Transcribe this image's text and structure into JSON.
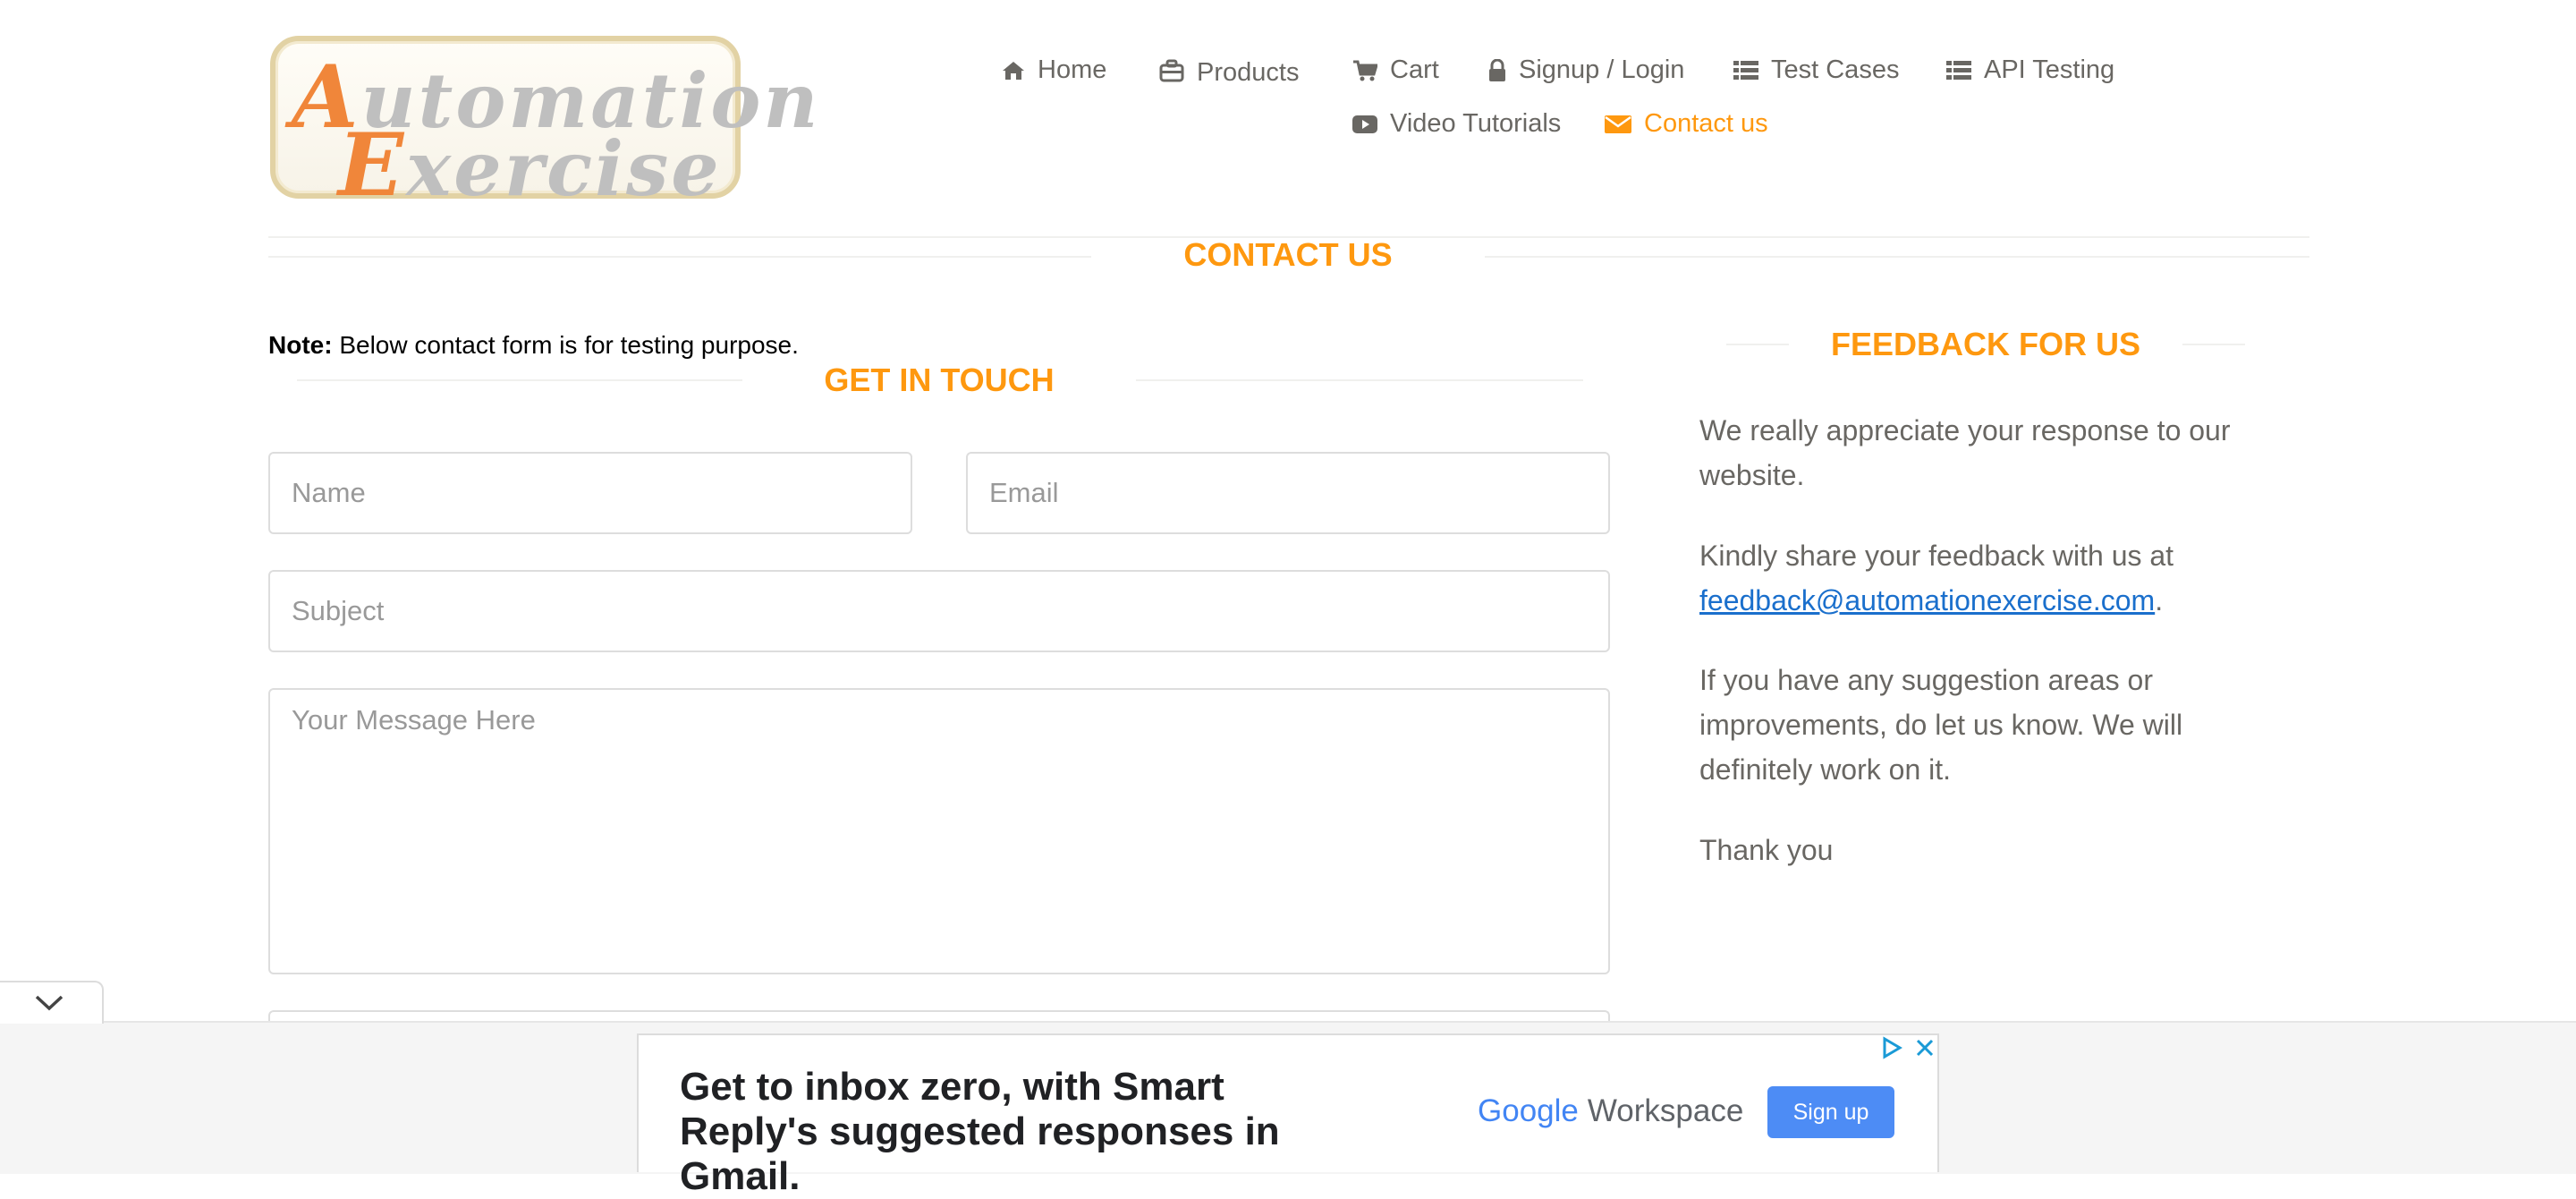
{
  "logo": {
    "line1_cap": "A",
    "line1_rest": "utomation",
    "line2_cap": "E",
    "line2_rest": "xercise"
  },
  "nav": {
    "home": "Home",
    "products": "Products",
    "cart": "Cart",
    "signup_login": "Signup / Login",
    "test_cases": "Test Cases",
    "api_testing": "API Testing",
    "video_tutorials": "Video Tutorials",
    "contact_us": "Contact us"
  },
  "page_title": "CONTACT US",
  "note": {
    "label": "Note:",
    "text": " Below contact form is for testing purpose."
  },
  "form": {
    "title": "GET IN TOUCH",
    "name_placeholder": "Name",
    "email_placeholder": "Email",
    "subject_placeholder": "Subject",
    "message_placeholder": "Your Message Here"
  },
  "feedback": {
    "title": "FEEDBACK FOR US",
    "p1": "We really appreciate your response to our website.",
    "p2_prefix": "Kindly share your feedback with us at ",
    "email": "feedback@automationexercise.com",
    "p2_suffix": ".",
    "p3": "If you have any suggestion areas or improvements, do let us know. We will definitely work on it.",
    "p4": "Thank you"
  },
  "ad": {
    "headline": "Get to inbox zero, with Smart Reply's suggested responses in Gmail.",
    "brand_g": "Google",
    "brand_w": "Workspace",
    "cta": "Sign up"
  },
  "colors": {
    "accent": "#FE980F",
    "text": "#696763",
    "link": "#1A6FCC",
    "ad_button": "#4D8CF5"
  },
  "icons": [
    "home-icon",
    "briefcase-icon",
    "cart-icon",
    "lock-icon",
    "list-icon",
    "youtube-icon",
    "envelope-icon",
    "chevron-down-icon",
    "adchoices-icon",
    "close-icon"
  ]
}
